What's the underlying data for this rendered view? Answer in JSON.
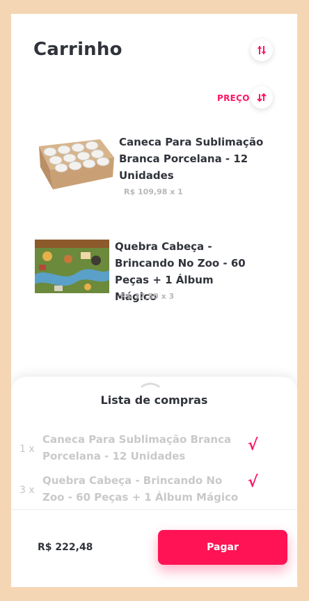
{
  "header": {
    "title": "Carrinho",
    "filter_icon": "filter-icon"
  },
  "sort": {
    "label": "PREÇO",
    "icon": "sort-icon"
  },
  "products": [
    {
      "name": "Caneca Para Sublimação Branca Porcelana - 12 Unidades",
      "price": "R$ 109,98 x 1",
      "image": "mug-box-image"
    },
    {
      "name": "Quebra Cabeça - Brincando No Zoo - 60 Peças + 1 Álbum Mágico",
      "price": "R$ 37,50 x 3",
      "image": "puzzle-image"
    }
  ],
  "sheet": {
    "title": "Lista de compras",
    "items": [
      {
        "qty": "1 x",
        "desc": "Caneca Para Sublimação Branca Porcelana - 12 Unidades",
        "check": "√"
      },
      {
        "qty": "3 x",
        "desc": "Quebra Cabeça - Brincando No Zoo - 60 Peças + 1 Álbum Mágico",
        "check": "√"
      }
    ],
    "total": "R$ 222,48",
    "pay_label": "Pagar"
  },
  "colors": {
    "accent": "#ff1763",
    "background": "#f5d6b4",
    "text": "#30333b"
  }
}
